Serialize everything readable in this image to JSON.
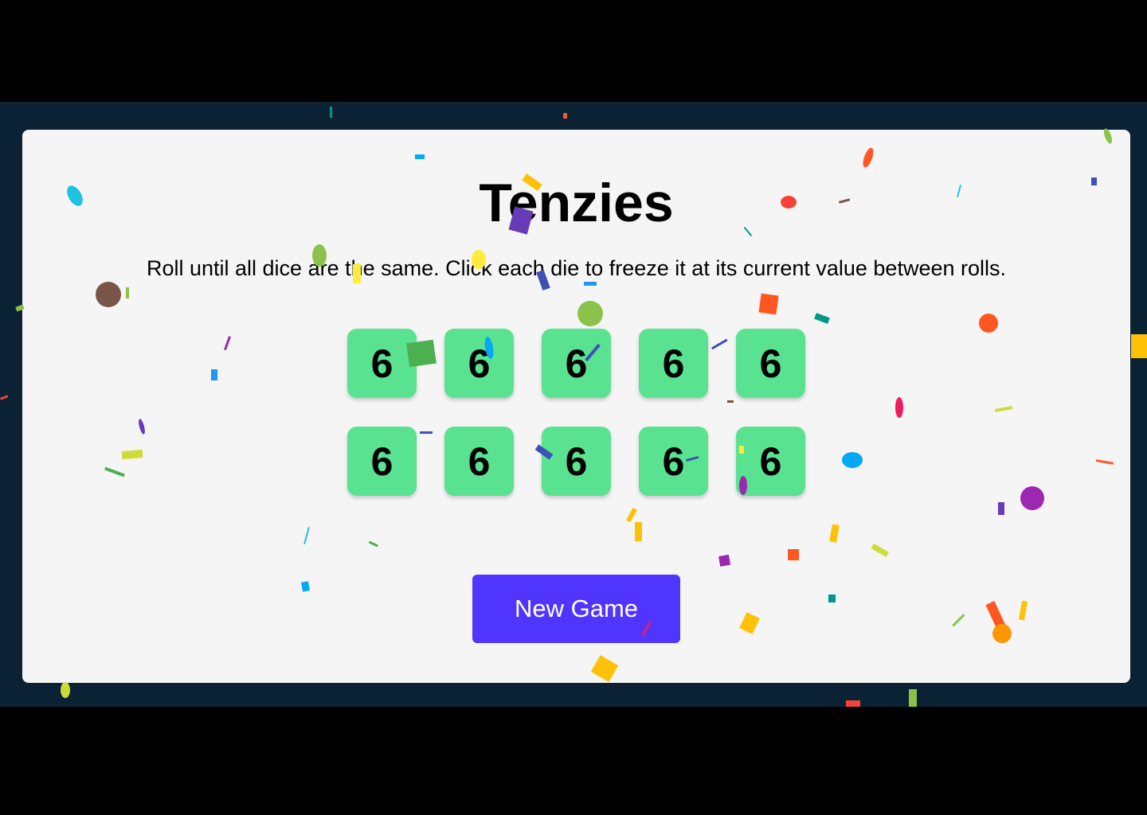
{
  "game": {
    "title": "Tenzies",
    "instructions": "Roll until all dice are the same. Click each die to freeze it at its current value between rolls.",
    "dice": [
      "6",
      "6",
      "6",
      "6",
      "6",
      "6",
      "6",
      "6",
      "6",
      "6"
    ],
    "new_game_label": "New Game"
  },
  "colors": {
    "page_background": "#0b2234",
    "card_background": "#f5f5f5",
    "die_held": "#59e391",
    "button": "#5035ff"
  }
}
